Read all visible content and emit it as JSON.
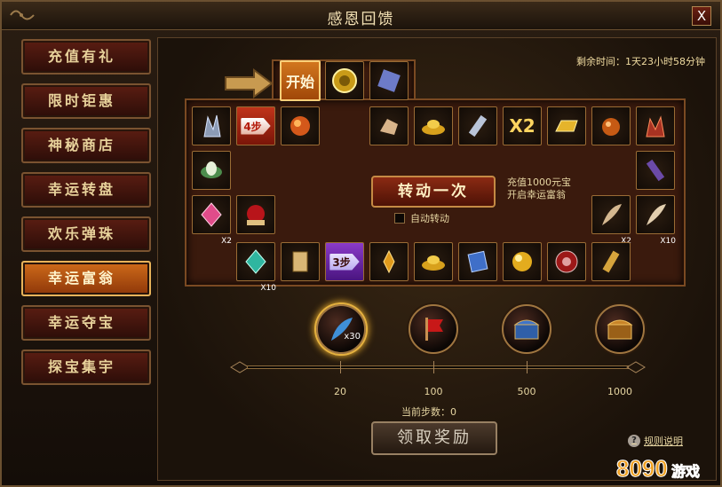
{
  "window": {
    "title": "感恩回馈",
    "close_label": "X"
  },
  "sidebar": {
    "items": [
      {
        "label": "充值有礼",
        "active": false
      },
      {
        "label": "限时钜惠",
        "active": false
      },
      {
        "label": "神秘商店",
        "active": false
      },
      {
        "label": "幸运转盘",
        "active": false
      },
      {
        "label": "欢乐弹珠",
        "active": false
      },
      {
        "label": "幸运富翁",
        "active": true
      },
      {
        "label": "幸运夺宝",
        "active": false
      },
      {
        "label": "探宝集宇",
        "active": false
      }
    ]
  },
  "timer": {
    "text": "剩余时间：1天23小时58分钟"
  },
  "board": {
    "start_label": "开始",
    "step4_label": "4步",
    "step3_label": "3步",
    "x2_label": "X2",
    "qty_x2": "X2",
    "qty_x10": "X10",
    "qty_x2b": "X2",
    "qty_x10b": "X10"
  },
  "spin": {
    "button_label": "转动一次",
    "note_line1": "充值1000元宝",
    "note_line2": "开启幸运富翁",
    "auto_label": "自动转动"
  },
  "rewards": {
    "first_qty": "x30"
  },
  "progress": {
    "ticks": [
      "20",
      "100",
      "500",
      "1000"
    ]
  },
  "step_count": {
    "label": "当前步数：0"
  },
  "claim": {
    "button_label": "领取奖励"
  },
  "rules": {
    "label": "规则说明",
    "help_glyph": "?"
  },
  "watermark": {
    "text": "8090游戏"
  },
  "colors": {
    "accent": "#d8a02a",
    "step_red": "#c0331a",
    "step_purple": "#8a3ac8"
  }
}
